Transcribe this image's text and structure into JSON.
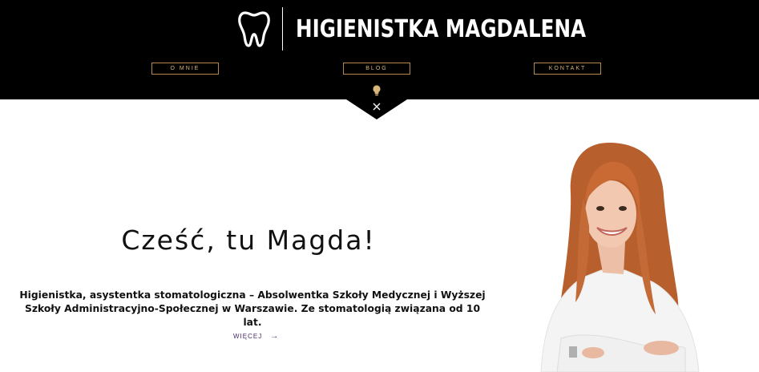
{
  "header": {
    "site_title": "HIGIENISTKA MAGDALENA",
    "logo_icon": "tooth-icon",
    "nav": [
      {
        "label": "O MNIE"
      },
      {
        "label": "BLOG"
      },
      {
        "label": "KONTAKT"
      }
    ],
    "toggle_icon": "lightbulb-icon",
    "close_icon": "close-icon"
  },
  "hero": {
    "title": "Cześć, tu Magda!",
    "description": "Higienistka, asystentka stomatologiczna – Absolwentka Szkoły Medycznej i Wyższej Szkoły Administracyjno-Społecznej w Warszawie. Ze stomatologią związana od 10 lat.",
    "more_label": "WIĘCEJ",
    "more_icon": "arrow-right-icon"
  },
  "colors": {
    "header_bg": "#000000",
    "accent_gold": "#b58a50",
    "link_purple": "#4a2a66"
  }
}
